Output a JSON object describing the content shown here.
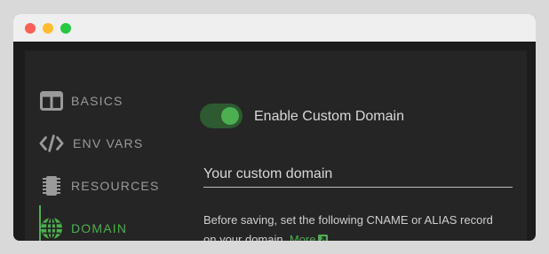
{
  "sidebar": {
    "items": [
      {
        "label": "BASICS",
        "icon": "layout-icon"
      },
      {
        "label": "ENV VARS",
        "icon": "code-icon"
      },
      {
        "label": "RESOURCES",
        "icon": "chip-icon"
      },
      {
        "label": "DOMAIN",
        "icon": "globe-icon",
        "active": true
      }
    ]
  },
  "domain": {
    "toggle_label": "Enable Custom Domain",
    "toggle_on": true,
    "input_placeholder": "Your custom domain",
    "help_text": "Before saving, set the following CNAME or ALIAS record on your domain.",
    "more_link": "More"
  },
  "colors": {
    "accent": "#4caf50",
    "panel": "#252525",
    "window": "#1c1c1c"
  }
}
